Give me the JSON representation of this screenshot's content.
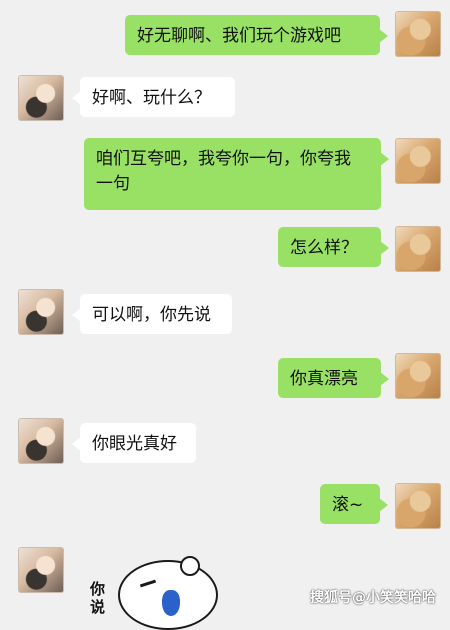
{
  "conversation": {
    "messages": [
      {
        "sender": "me",
        "text": "好无聊啊、我们玩个游戏吧"
      },
      {
        "sender": "other",
        "text": "好啊、玩什么？"
      },
      {
        "sender": "me",
        "text": "咱们互夸吧，我夸你一句，你夸我一句"
      },
      {
        "sender": "me",
        "text": "怎么样？"
      },
      {
        "sender": "other",
        "text": "可以啊，你先说"
      },
      {
        "sender": "me",
        "text": "你真漂亮"
      },
      {
        "sender": "other",
        "text": "你眼光真好"
      },
      {
        "sender": "me",
        "text": "滚~"
      }
    ],
    "sticker": {
      "text": "你说"
    }
  },
  "watermark": "搜狐号@小笑笑哈哈",
  "colors": {
    "background": "#f0f0f0",
    "my_bubble": "#98e165",
    "other_bubble": "#ffffff"
  },
  "icons": {
    "my_avatar": "avatar-photo",
    "other_avatar": "avatar-photo",
    "sticker": "crying-face-sticker"
  }
}
